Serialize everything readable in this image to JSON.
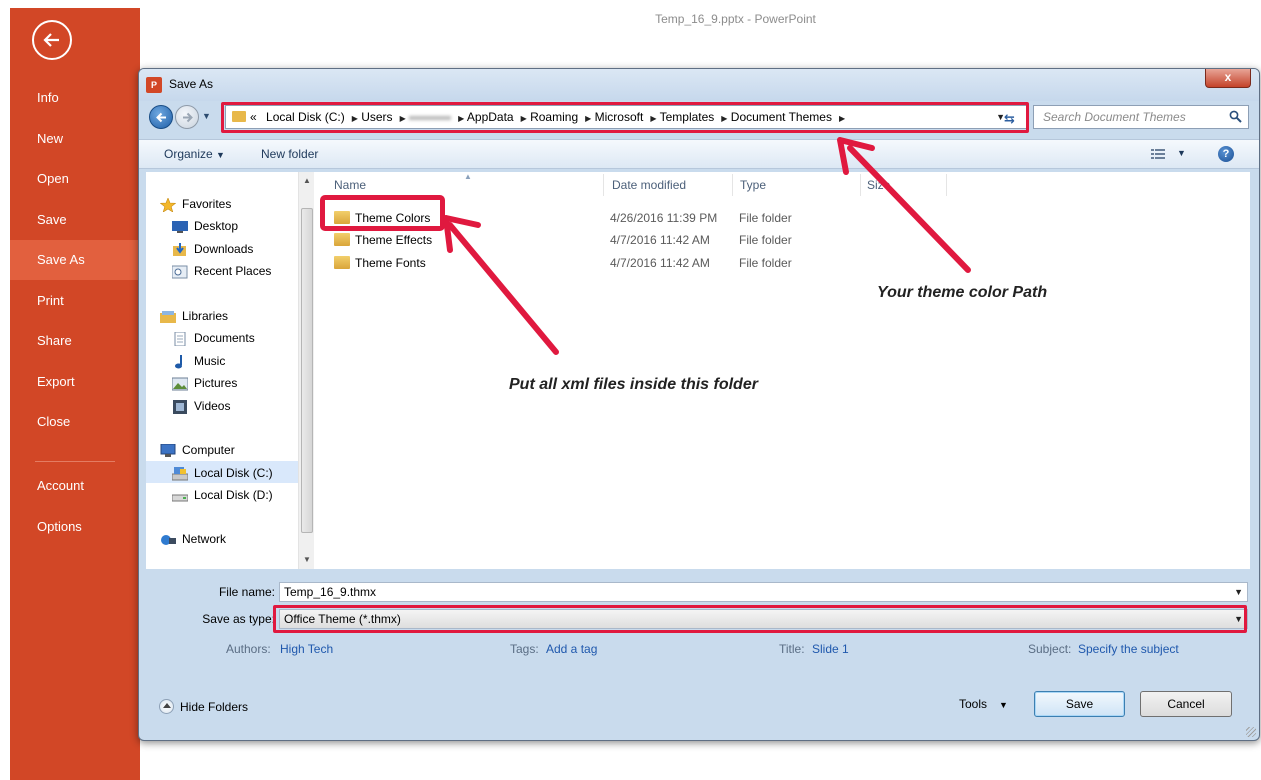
{
  "window": {
    "title": "Temp_16_9.pptx - PowerPoint"
  },
  "backstage": {
    "items": [
      {
        "label": "Info"
      },
      {
        "label": "New"
      },
      {
        "label": "Open"
      },
      {
        "label": "Save"
      },
      {
        "label": "Save As",
        "active": true
      },
      {
        "label": "Print"
      },
      {
        "label": "Share"
      },
      {
        "label": "Export"
      },
      {
        "label": "Close"
      },
      {
        "label": "Account"
      },
      {
        "label": "Options"
      }
    ],
    "accent": "#d24726",
    "active_color": "#e2603e"
  },
  "dialog": {
    "title": "Save As",
    "app_icon_text": "P",
    "close_label": "x",
    "address": {
      "crumbs": [
        "Local Disk (C:)",
        "Users",
        "AppData",
        "Roaming",
        "Microsoft",
        "Templates",
        "Document Themes"
      ],
      "prefix": "«"
    },
    "search_placeholder": "Search Document Themes",
    "toolbar": {
      "organize": "Organize",
      "new_folder": "New folder",
      "help": "?"
    },
    "nav": {
      "favorites": "Favorites",
      "desktop": "Desktop",
      "downloads": "Downloads",
      "recent": "Recent Places",
      "libraries": "Libraries",
      "documents": "Documents",
      "music": "Music",
      "pictures": "Pictures",
      "videos": "Videos",
      "computer": "Computer",
      "local_c": "Local Disk (C:)",
      "local_d": "Local Disk (D:)",
      "network": "Network"
    },
    "columns": {
      "name": "Name",
      "date": "Date modified",
      "type": "Type",
      "size": "Size"
    },
    "files": [
      {
        "name": "Theme Colors",
        "date": "4/26/2016 11:39 PM",
        "type": "File folder"
      },
      {
        "name": "Theme Effects",
        "date": "4/7/2016 11:42 AM",
        "type": "File folder"
      },
      {
        "name": "Theme Fonts",
        "date": "4/7/2016 11:42 AM",
        "type": "File folder"
      }
    ],
    "file_name_label": "File name:",
    "file_name": "Temp_16_9.thmx",
    "save_type_label": "Save as type:",
    "save_type": "Office Theme (*.thmx)",
    "meta": {
      "authors_label": "Authors:",
      "authors": "High Tech",
      "tags_label": "Tags:",
      "tags": "Add a tag",
      "title_label": "Title:",
      "title": "Slide 1",
      "subject_label": "Subject:",
      "subject": "Specify the subject"
    },
    "hide_folders": "Hide Folders",
    "tools": "Tools",
    "save_button": "Save",
    "cancel_button": "Cancel"
  },
  "annotations": {
    "path_note": "Your theme color Path",
    "folder_note": "Put all xml files inside this folder",
    "color": "#e0193f"
  }
}
